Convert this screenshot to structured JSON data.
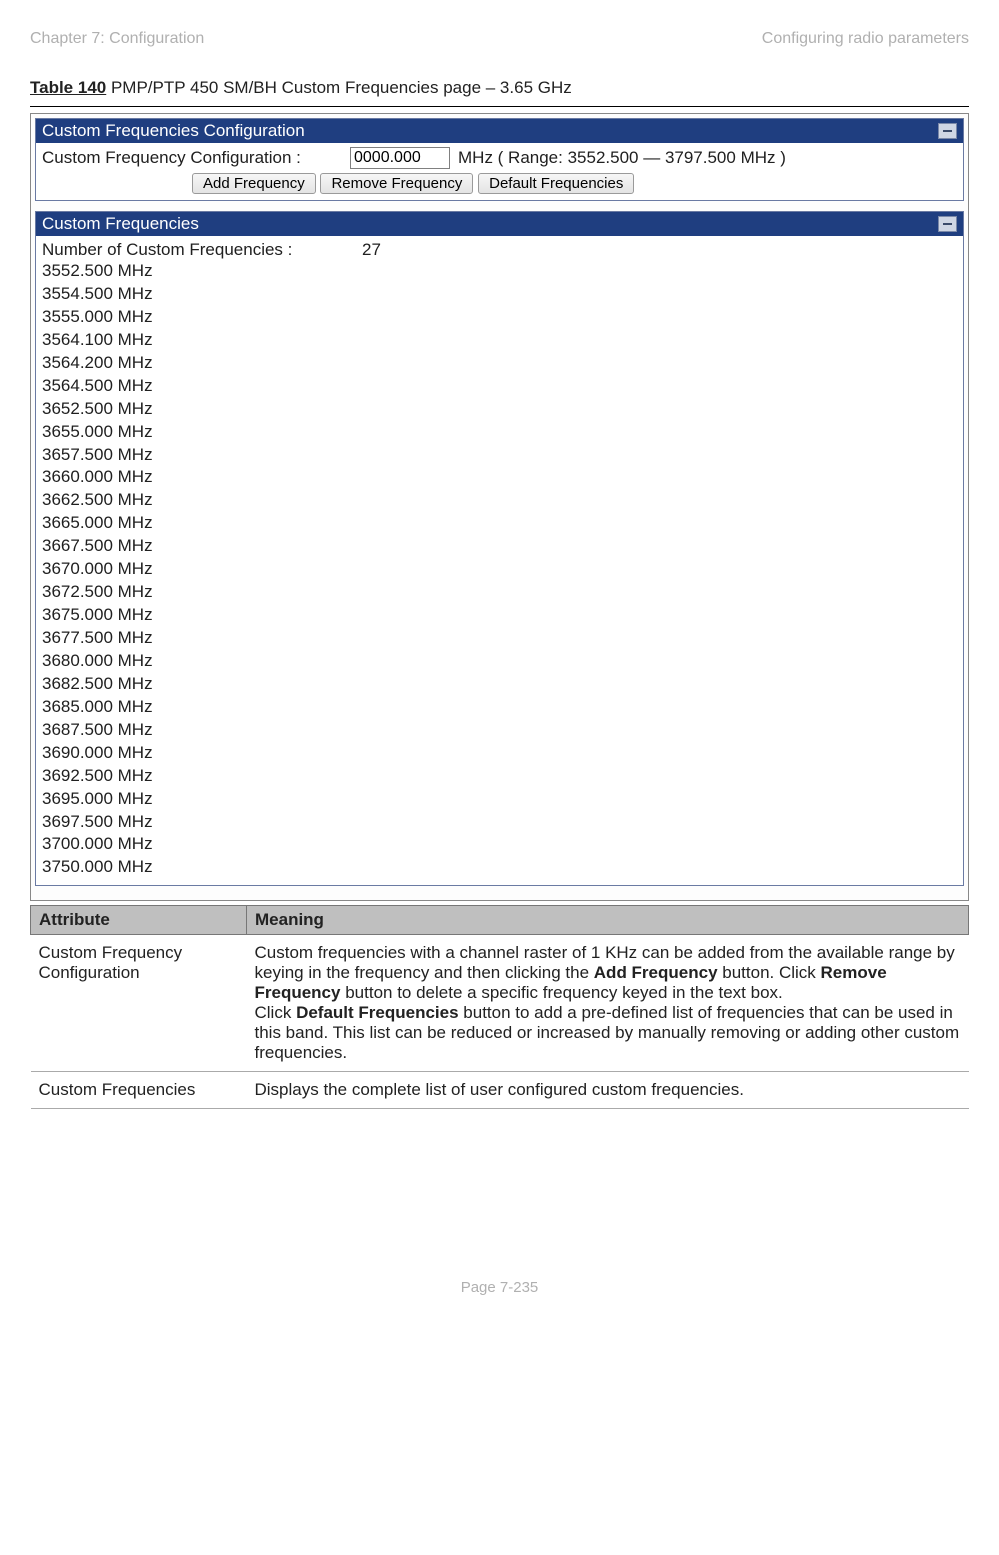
{
  "header": {
    "left": "Chapter 7:  Configuration",
    "right": "Configuring radio parameters"
  },
  "caption": {
    "tablenum": "Table 140",
    "rest": " PMP/PTP 450 SM/BH Custom Frequencies page – 3.65 GHz"
  },
  "panel1": {
    "title": "Custom Frequencies Configuration",
    "cfg_label": "Custom Frequency Configuration :",
    "cfg_value": "0000.000",
    "units_range": "MHz ( Range: 3552.500 — 3797.500 MHz )",
    "btn_add": "Add Frequency",
    "btn_remove": "Remove Frequency",
    "btn_default": "Default Frequencies"
  },
  "panel2": {
    "title": "Custom Frequencies",
    "count_label": "Number of Custom Frequencies :",
    "count_value": "27",
    "frequencies": [
      "3552.500 MHz",
      "3554.500 MHz",
      "3555.000 MHz",
      "3564.100 MHz",
      "3564.200 MHz",
      "3564.500 MHz",
      "3652.500 MHz",
      "3655.000 MHz",
      "3657.500 MHz",
      "3660.000 MHz",
      "3662.500 MHz",
      "3665.000 MHz",
      "3667.500 MHz",
      "3670.000 MHz",
      "3672.500 MHz",
      "3675.000 MHz",
      "3677.500 MHz",
      "3680.000 MHz",
      "3682.500 MHz",
      "3685.000 MHz",
      "3687.500 MHz",
      "3690.000 MHz",
      "3692.500 MHz",
      "3695.000 MHz",
      "3697.500 MHz",
      "3700.000 MHz",
      "3750.000 MHz"
    ]
  },
  "table": {
    "h1": "Attribute",
    "h2": "Meaning",
    "r1a": "Custom Frequency Configuration",
    "r1b_pre": "Custom frequencies with a channel raster of 1 KHz can be added from the available range by keying in the frequency and then clicking the ",
    "r1b_b1": "Add Frequency",
    "r1b_mid1": " button. Click ",
    "r1b_b2": "Remove Frequency",
    "r1b_mid2": " button to delete a specific frequency keyed in the text box.",
    "r1b_p2pre": "Click ",
    "r1b_b3": "Default Frequencies",
    "r1b_p2post": " button to add a pre-defined list of frequencies that can be used in this band. This list can be reduced or increased by manually removing or adding other custom frequencies.",
    "r2a": "Custom Frequencies",
    "r2b": "Displays the complete list of user configured custom frequencies."
  },
  "footer": "Page 7-235"
}
